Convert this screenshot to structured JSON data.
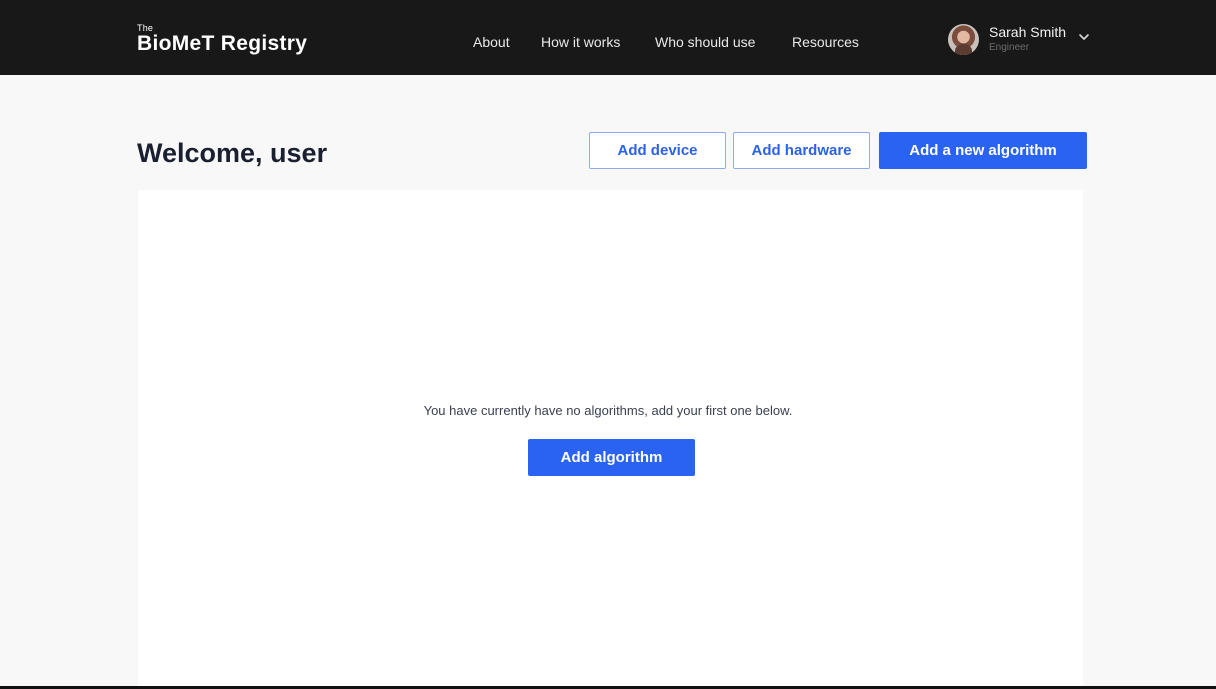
{
  "header": {
    "logo_small": "The",
    "logo_main": "BioMeT Registry",
    "nav": [
      "About",
      "How it works",
      "Who should use",
      "Resources"
    ],
    "user": {
      "name": "Sarah Smith",
      "role": "Engineer"
    }
  },
  "main": {
    "welcome": "Welcome, user",
    "actions": {
      "add_device": "Add device",
      "add_hardware": "Add hardware",
      "add_new_algorithm": "Add a new algorithm"
    },
    "empty_state": {
      "message": "You have currently have no algorithms, add your first one below.",
      "cta": "Add algorithm"
    }
  },
  "colors": {
    "header_bg": "#181818",
    "accent": "#2a62f2",
    "page_bg": "#f8f8f8"
  },
  "icons": {
    "avatar": "user-avatar",
    "chevron": "chevron-down-icon"
  }
}
